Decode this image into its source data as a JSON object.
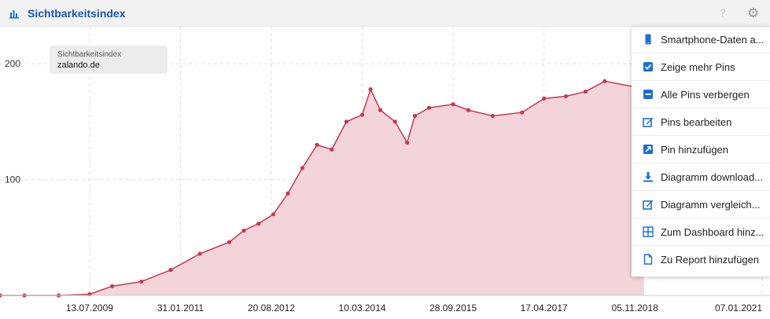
{
  "header": {
    "title": "Sichtbarkeitsindex",
    "help": "?"
  },
  "tooltip": {
    "label": "Sichtbarkeitsindex",
    "domain": "zalando.de"
  },
  "menu": [
    {
      "label": "Smartphone-Daten a...",
      "icon": "smartphone-icon"
    },
    {
      "label": "Zeige mehr Pins",
      "icon": "checkbox-icon"
    },
    {
      "label": "Alle Pins verbergen",
      "icon": "minus-box-icon"
    },
    {
      "label": "Pins bearbeiten",
      "icon": "edit-icon"
    },
    {
      "label": "Pin hinzufügen",
      "icon": "add-pin-icon"
    },
    {
      "label": "Diagramm download...",
      "icon": "download-icon"
    },
    {
      "label": "Diagramm vergleich...",
      "icon": "compare-icon"
    },
    {
      "label": "Zum Dashboard hinz...",
      "icon": "dashboard-icon"
    },
    {
      "label": "Zu Report hinzufügen",
      "icon": "report-icon"
    }
  ],
  "colors": {
    "line": "#c8384f",
    "fill": "#f3d4da",
    "title": "#1a56b8",
    "icon": "#1a6fd8"
  },
  "chart_data": {
    "type": "area",
    "title": "Sichtbarkeitsindex",
    "ylim": [
      0,
      232
    ],
    "yticks": [
      100,
      200
    ],
    "xticks": [
      "13.07.2009",
      "31.01.2011",
      "20.08.2012",
      "10.03.2014",
      "28.09.2015",
      "17.04.2017",
      "05.11.2018",
      "07.01.2021"
    ],
    "grid": true,
    "x": [
      "2008-01-01",
      "2008-06-01",
      "2009-01-01",
      "2009-07-13",
      "2009-12-01",
      "2010-06-01",
      "2010-12-01",
      "2011-06-01",
      "2011-12-01",
      "2012-03-01",
      "2012-06-01",
      "2012-09-01",
      "2012-12-01",
      "2013-03-01",
      "2013-06-01",
      "2013-09-01",
      "2013-12-01",
      "2014-03-10",
      "2014-05-01",
      "2014-07-01",
      "2014-10-01",
      "2014-12-15",
      "2015-02-01",
      "2015-05-01",
      "2015-09-28",
      "2016-01-01",
      "2016-06-01",
      "2016-12-01",
      "2017-04-17",
      "2017-09-01",
      "2018-01-01",
      "2018-05-01",
      "2018-11-05",
      "2019-01-01"
    ],
    "values": [
      0,
      0,
      0,
      1,
      8,
      12,
      22,
      36,
      46,
      56,
      62,
      70,
      88,
      110,
      130,
      126,
      150,
      156,
      178,
      160,
      150,
      132,
      155,
      162,
      165,
      160,
      155,
      158,
      170,
      172,
      176,
      185,
      180,
      178
    ]
  }
}
